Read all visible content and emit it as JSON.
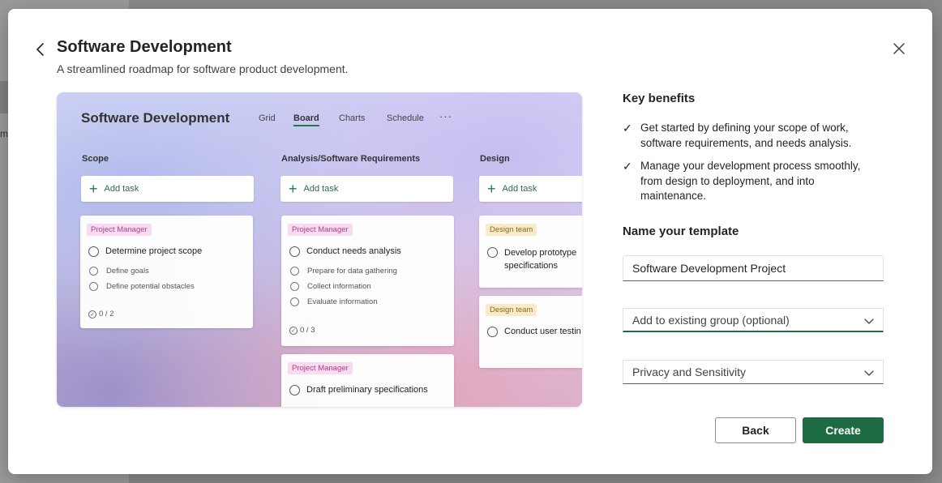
{
  "backdrop": {
    "fragment": "m"
  },
  "dialog": {
    "title": "Software Development",
    "subtitle": "A streamlined roadmap for software product development."
  },
  "preview": {
    "title": "Software Development",
    "tabs": [
      "Grid",
      "Board",
      "Charts",
      "Schedule"
    ],
    "active_tab": "Board",
    "more": "···",
    "columns": [
      {
        "header": "Scope",
        "add_task": "Add task",
        "cards": [
          {
            "tag": "Project Manager",
            "task": "Determine project scope",
            "subtasks": [
              "Define goals",
              "Define potential obstacles"
            ],
            "progress": "0 / 2"
          }
        ]
      },
      {
        "header": "Analysis/Software Requirements",
        "add_task": "Add task",
        "cards": [
          {
            "tag": "Project Manager",
            "task": "Conduct needs analysis",
            "subtasks": [
              "Prepare for data gathering",
              "Collect information",
              "Evaluate information"
            ],
            "progress": "0 / 3"
          },
          {
            "tag": "Project Manager",
            "task": "Draft preliminary specifications"
          }
        ]
      },
      {
        "header": "Design",
        "add_task": "Add task",
        "cards": [
          {
            "tag": "Design team",
            "task": "Develop prototype specifications"
          },
          {
            "tag": "Design team",
            "task": "Conduct user testin"
          }
        ]
      }
    ]
  },
  "key_benefits": {
    "title": "Key benefits",
    "items": [
      "Get started by defining your scope of work, software requirements, and needs analysis.",
      "Manage your development process smoothly, from design to deployment, and into maintenance."
    ]
  },
  "name_template": {
    "title": "Name your template",
    "value": "Software Development Project",
    "group_placeholder": "Add to existing group (optional)",
    "privacy_label": "Privacy and Sensitivity"
  },
  "buttons": {
    "back": "Back",
    "create": "Create"
  },
  "colors": {
    "accent": "#1d6b43",
    "pm_tag_bg": "#f6dcee",
    "design_tag_bg": "#f7ebc9"
  }
}
